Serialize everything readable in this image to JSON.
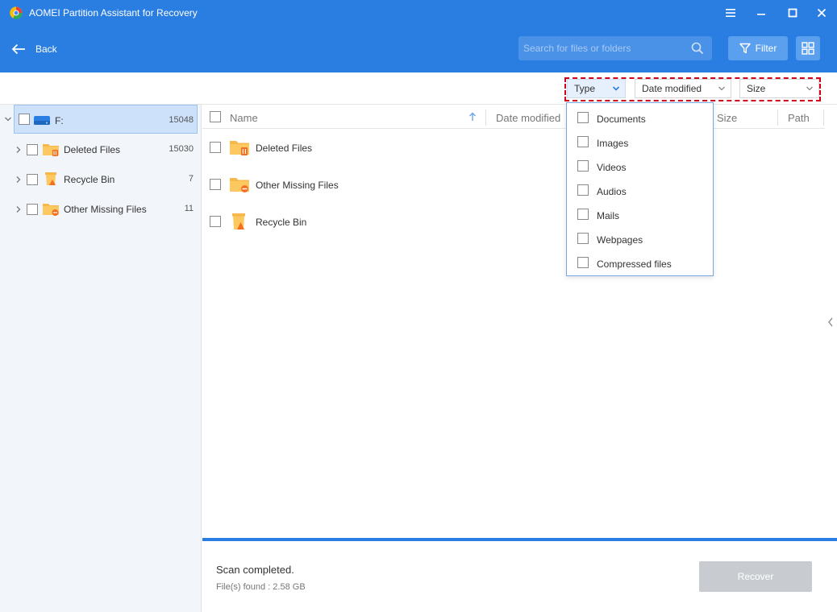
{
  "window": {
    "title": "AOMEI Partition Assistant for Recovery"
  },
  "header": {
    "back_label": "Back",
    "search_placeholder": "Search for files or folders",
    "filter_label": "Filter"
  },
  "filters": {
    "type_label": "Type",
    "date_label": "Date modified",
    "size_label": "Size"
  },
  "type_dropdown": {
    "options": [
      "Documents",
      "Images",
      "Videos",
      "Audios",
      "Mails",
      "Webpages",
      "Compressed files"
    ]
  },
  "sidebar": {
    "root": {
      "label": "F:",
      "count": "15048"
    },
    "items": [
      {
        "label": "Deleted Files",
        "count": "15030"
      },
      {
        "label": "Recycle Bin",
        "count": "7"
      },
      {
        "label": "Other Missing Files",
        "count": "11"
      }
    ]
  },
  "columns": {
    "name": "Name",
    "date": "Date modified",
    "size": "Size",
    "path": "Path"
  },
  "files": [
    {
      "label": "Deleted Files"
    },
    {
      "label": "Other Missing Files"
    },
    {
      "label": "Recycle Bin"
    }
  ],
  "status": {
    "scan": "Scan completed.",
    "found": "File(s) found : 2.58 GB",
    "recover_label": "Recover"
  },
  "colors": {
    "accent": "#2a7de1",
    "selected_row": "#cde2fa",
    "highlight_border": "#d0021b",
    "folder": "#f7b84b",
    "badge": "#f36f21"
  },
  "icons": {
    "logo": "app-logo-icon",
    "back": "back-arrow-icon",
    "search": "search-icon",
    "filter": "funnel-icon",
    "view": "grid-view-icon",
    "drive": "drive-icon",
    "folder_deleted": "folder-trash-icon",
    "folder_missing": "folder-missing-icon",
    "recycle": "recycle-bin-icon"
  }
}
